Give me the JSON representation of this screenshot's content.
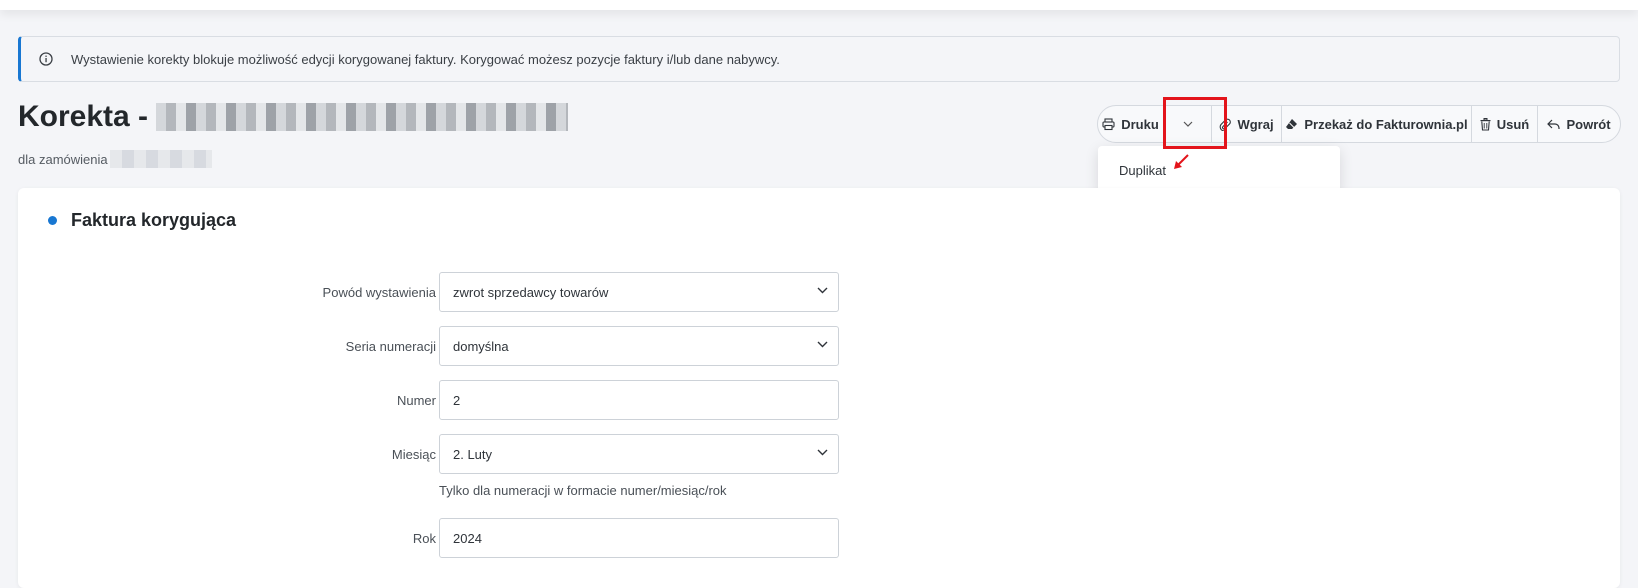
{
  "alert": {
    "icon": "info-circle-icon",
    "message": "Wystawienie korekty blokuje możliwość edycji korygowanej faktury. Korygować możesz pozycje faktury i/lub dane nabywcy."
  },
  "header": {
    "title": "Korekta -",
    "subtitle": "dla zamówienia"
  },
  "toolbar": {
    "print_label": "Druku",
    "upload_label": "Wgraj",
    "transfer_label": "Przekaż do Fakturownia.pl",
    "delete_label": "Usuń",
    "back_label": "Powrót"
  },
  "dropdown": {
    "items": [
      "Duplikat"
    ]
  },
  "card": {
    "title": "Faktura korygująca"
  },
  "form": {
    "reason": {
      "label": "Powód wystawienia",
      "value": "zwrot sprzedawcy towarów"
    },
    "series": {
      "label": "Seria numeracji",
      "value": "domyślna"
    },
    "number": {
      "label": "Numer",
      "value": "2"
    },
    "month": {
      "label": "Miesiąc",
      "value": "2. Luty",
      "hint": "Tylko dla numeracji w formacie numer/miesiąc/rok"
    },
    "year": {
      "label": "Rok",
      "value": "2024"
    }
  },
  "colors": {
    "accent": "#1877d2",
    "highlight": "#e3141b"
  }
}
